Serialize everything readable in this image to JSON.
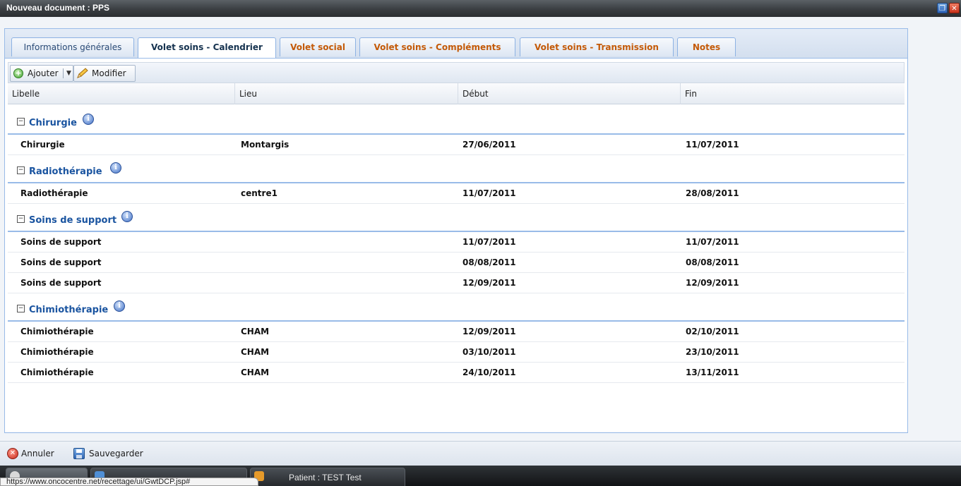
{
  "window": {
    "title": "Nouveau document : PPS",
    "restore_icon": "restore-window-icon",
    "close_icon": "close-icon"
  },
  "tabs": [
    {
      "label": "Informations générales",
      "style": "normal"
    },
    {
      "label": "Volet soins - Calendrier",
      "style": "active"
    },
    {
      "label": "Volet social",
      "style": "orange"
    },
    {
      "label": "Volet soins - Compléments",
      "style": "orange"
    },
    {
      "label": "Volet soins - Transmission",
      "style": "orange"
    },
    {
      "label": "Notes",
      "style": "orange"
    }
  ],
  "toolbar": {
    "add_label": "Ajouter",
    "edit_label": "Modifier"
  },
  "grid": {
    "columns": [
      "Libelle",
      "Lieu",
      "Début",
      "Fin"
    ],
    "groups": [
      {
        "name": "Chirurgie",
        "rows": [
          {
            "libelle": "Chirurgie",
            "lieu": "Montargis",
            "debut": "27/06/2011",
            "fin": "11/07/2011"
          }
        ]
      },
      {
        "name": "Radiothérapie",
        "rows": [
          {
            "libelle": "Radiothérapie",
            "lieu": "centre1",
            "debut": "11/07/2011",
            "fin": "28/08/2011"
          }
        ]
      },
      {
        "name": "Soins de support",
        "rows": [
          {
            "libelle": "Soins de support",
            "lieu": "",
            "debut": "11/07/2011",
            "fin": "11/07/2011"
          },
          {
            "libelle": "Soins de support",
            "lieu": "",
            "debut": "08/08/2011",
            "fin": "08/08/2011"
          },
          {
            "libelle": "Soins de support",
            "lieu": "",
            "debut": "12/09/2011",
            "fin": "12/09/2011"
          }
        ]
      },
      {
        "name": "Chimiothérapie",
        "rows": [
          {
            "libelle": "Chimiothérapie",
            "lieu": "CHAM",
            "debut": "12/09/2011",
            "fin": "02/10/2011"
          },
          {
            "libelle": "Chimiothérapie",
            "lieu": "CHAM",
            "debut": "03/10/2011",
            "fin": "23/10/2011"
          },
          {
            "libelle": "Chimiothérapie",
            "lieu": "CHAM",
            "debut": "24/10/2011",
            "fin": "13/11/2011"
          }
        ]
      }
    ]
  },
  "footer": {
    "cancel_label": "Annuler",
    "save_label": "Sauvegarder"
  },
  "taskbar": {
    "status_url": "https://www.oncocentre.net/recettage/ui/GwtDCP.jsp#",
    "active_task": "Patient : TEST Test"
  },
  "colors": {
    "accent_blue": "#99bbe8",
    "tab_orange": "#c45a08",
    "group_blue": "#1a54a0"
  }
}
